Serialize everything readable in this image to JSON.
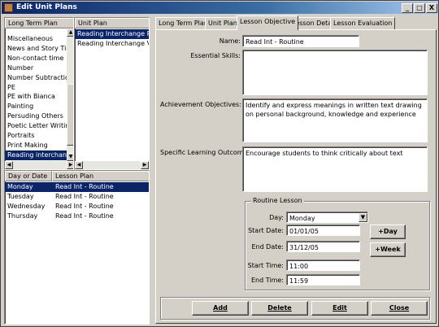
{
  "window": {
    "title": "Edit Unit Plans",
    "controls": [
      "_",
      "□",
      "X"
    ]
  },
  "left": {
    "ltp_header": "Long Term Plan",
    "up_header": "Unit Plan",
    "ltp_items": [
      "Miscellaneous",
      "News and Story Time",
      "Non-contact time",
      "Number",
      "Number Subtraction",
      "PE",
      "PE with Bianca",
      "Painting",
      "Persuding Others",
      "Poetic Letter Writing",
      "Portraits",
      "Print Making",
      "Reading interchange"
    ],
    "up_items": [
      "Reading Interchange Ro",
      "Reading Interchange Va"
    ],
    "sched_headers": [
      "Day or Date",
      "Lesson Plan"
    ],
    "sched_rows": [
      {
        "day": "Monday",
        "plan": "Read Int - Routine"
      },
      {
        "day": "Tuesday",
        "plan": "Read Int - Routine"
      },
      {
        "day": "Wednesday",
        "plan": "Read Int - Routine"
      },
      {
        "day": "Thursday",
        "plan": "Read Int - Routine"
      }
    ]
  },
  "tabs": [
    "Long Term Plans",
    "Unit Plans",
    "Lesson Objective",
    "Lesson Detail",
    "Lesson Evaluation"
  ],
  "form": {
    "name_label": "Name:",
    "name_value": "Read Int - Routine",
    "skills_label": "Essential Skills:",
    "skills_value": "",
    "achieve_label": "Achievement Objectives:",
    "achieve_value": "Identify and express meanings in written text drawing on personal background, knowledge and experience",
    "slo_label": "Specific Learning Outcomes:",
    "slo_value": "Encourage students to think critically about text"
  },
  "routine": {
    "title": "Routine Lesson",
    "day_label": "Day:",
    "day_value": "Monday",
    "start_date_label": "Start Date:",
    "start_date": "01/01/05",
    "end_date_label": "End Date:",
    "end_date": "31/12/05",
    "start_time_label": "Start Time:",
    "start_time": "11:00",
    "end_time_label": "End Time:",
    "end_time": "11:59",
    "plus_day": "+Day",
    "plus_week": "+Week"
  },
  "buttons": {
    "add": "Add",
    "delete": "Delete",
    "edit": "Edit",
    "close": "Close"
  }
}
